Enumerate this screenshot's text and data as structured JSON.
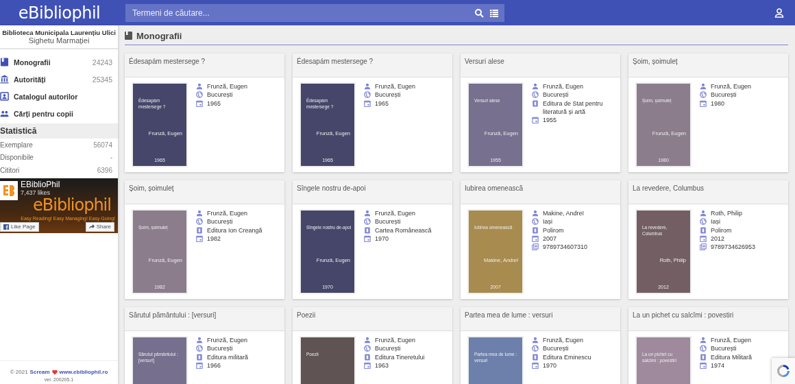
{
  "header": {
    "logo": "eBibliophil",
    "search": {
      "placeholder": "Termeni de căutare..."
    }
  },
  "sidebar": {
    "library_name": "Biblioteca Municipala Laurențiu Ulici",
    "library_city": "Sighetu Marmației",
    "items": [
      {
        "kind": "book",
        "label": "Monografii",
        "count": "24243"
      },
      {
        "kind": "institution",
        "label": "Autorități",
        "count": "25345"
      },
      {
        "kind": "contact",
        "label": "Catalogul autorilor"
      },
      {
        "kind": "people",
        "label": "Cărți pentru copii"
      }
    ],
    "stats_title": "Statistică",
    "stats": [
      {
        "label": "Exemplare",
        "value": "56074"
      },
      {
        "label": "Disponibile",
        "value": "-"
      },
      {
        "label": "Cititori",
        "value": "6396"
      }
    ],
    "facebook": {
      "page_name": "EBiblioPhil",
      "likes": "7,437 likes",
      "banner_title": "eBibliophil",
      "banner_tagline": "Easy Reading! Easy Managing! Easy Going!",
      "like_button": "Like Page",
      "share_button": "Share"
    },
    "footer": {
      "copyright": "© 2021",
      "author": "Scream",
      "site": "www.ebibliophil.ro",
      "version": "ver. 200205.1"
    }
  },
  "section": {
    "title": "Monografii"
  },
  "books": [
    {
      "title": "Édesapám mestersege ?",
      "cover": {
        "color": "#45466a",
        "title": "Édesapám mestersege ?",
        "author": "Frunză, Eugen",
        "year": "1965"
      },
      "details": [
        {
          "kind": "author",
          "text": "Frunză, Eugen"
        },
        {
          "kind": "place",
          "text": "București"
        },
        {
          "kind": "year",
          "text": "1965"
        }
      ]
    },
    {
      "title": "Édesapám mestersege ?",
      "cover": {
        "color": "#45466a",
        "title": "Édesapám mestersege ?",
        "author": "Frunză, Eugen",
        "year": "1965"
      },
      "details": [
        {
          "kind": "author",
          "text": "Frunză, Eugen"
        },
        {
          "kind": "place",
          "text": "București"
        },
        {
          "kind": "year",
          "text": "1965"
        }
      ]
    },
    {
      "title": "Versuri alese",
      "cover": {
        "color": "#77708f",
        "title": "Versuri alese",
        "author": "Frunză, Eugen",
        "year": "1955"
      },
      "details": [
        {
          "kind": "author",
          "text": "Frunză, Eugen"
        },
        {
          "kind": "place",
          "text": "București"
        },
        {
          "kind": "publisher",
          "text": "Editura de Stat pentru literatură și artă"
        },
        {
          "kind": "year",
          "text": "1955"
        }
      ]
    },
    {
      "title": "Șoim, șoimuleț",
      "cover": {
        "color": "#8b7d8c",
        "title": "Șoim, șoimuleț",
        "author": "Frunză, Eugen",
        "year": "1980"
      },
      "details": [
        {
          "kind": "author",
          "text": "Frunză, Eugen"
        },
        {
          "kind": "place",
          "text": "București"
        },
        {
          "kind": "year",
          "text": "1980"
        }
      ]
    },
    {
      "title": "Șoim, șoimuleț",
      "cover": {
        "color": "#8b7d8c",
        "title": "Șoim, șoimuleț",
        "author": "Frunză, Eugen",
        "year": "1982"
      },
      "details": [
        {
          "kind": "author",
          "text": "Frunză, Eugen"
        },
        {
          "kind": "place",
          "text": "București"
        },
        {
          "kind": "publisher",
          "text": "Editura Ion Creangă"
        },
        {
          "kind": "year",
          "text": "1982"
        }
      ]
    },
    {
      "title": "Sîngele nostru de-apoi",
      "cover": {
        "color": "#45466a",
        "title": "Sîngele nostru de-apoi",
        "author": "Frunză, Eugen",
        "year": "1970"
      },
      "details": [
        {
          "kind": "author",
          "text": "Frunză, Eugen"
        },
        {
          "kind": "place",
          "text": "București"
        },
        {
          "kind": "publisher",
          "text": "Cartea Românească"
        },
        {
          "kind": "year",
          "text": "1970"
        }
      ]
    },
    {
      "title": "Iubirea omenească",
      "cover": {
        "color": "#a88b4e",
        "title": "Iubirea omenească",
        "author": "Makine, Andreï",
        "year": "2007"
      },
      "details": [
        {
          "kind": "author",
          "text": "Makine, Andreï"
        },
        {
          "kind": "place",
          "text": "Iași"
        },
        {
          "kind": "publisher",
          "text": "Polirom"
        },
        {
          "kind": "year",
          "text": "2007"
        },
        {
          "kind": "isbn",
          "text": "9789734607310"
        }
      ]
    },
    {
      "title": "La revedere, Columbus",
      "cover": {
        "color": "#735f63",
        "title": "La revedere, Columbus",
        "author": "Roth, Philip",
        "year": "2012"
      },
      "details": [
        {
          "kind": "author",
          "text": "Roth, Philip"
        },
        {
          "kind": "place",
          "text": "Iași"
        },
        {
          "kind": "publisher",
          "text": "Polirom"
        },
        {
          "kind": "year",
          "text": "2012"
        },
        {
          "kind": "isbn",
          "text": "9789734626953"
        }
      ]
    },
    {
      "title": "Sărutul pământului : [versuri]",
      "cover": {
        "color": "#776f8e",
        "title": "Sărutul pământului : [versuri]"
      },
      "details": [
        {
          "kind": "author",
          "text": "Frunză, Eugen"
        },
        {
          "kind": "place",
          "text": "București"
        },
        {
          "kind": "publisher",
          "text": "Editura militară"
        },
        {
          "kind": "year",
          "text": "1966"
        }
      ]
    },
    {
      "title": "Poezii",
      "cover": {
        "color": "#5f5453",
        "title": "Poezii"
      },
      "details": [
        {
          "kind": "author",
          "text": "Frunză, Eugen"
        },
        {
          "kind": "place",
          "text": "București"
        },
        {
          "kind": "publisher",
          "text": "Editura Tineretului"
        },
        {
          "kind": "year",
          "text": "1963"
        }
      ]
    },
    {
      "title": "Partea mea de lume : versuri",
      "cover": {
        "color": "#6d80ab",
        "title": "Partea mea de lume : versuri"
      },
      "details": [
        {
          "kind": "author",
          "text": "Frunză, Eugen"
        },
        {
          "kind": "place",
          "text": "București"
        },
        {
          "kind": "publisher",
          "text": "Editura Eminescu"
        },
        {
          "kind": "year",
          "text": "1970"
        }
      ]
    },
    {
      "title": "La un pichet cu salcîmi : povestiri",
      "cover": {
        "color": "#9e8a9c",
        "title": "La un pichet cu salcîmi : povestiri"
      },
      "details": [
        {
          "kind": "author",
          "text": "Frunză, Eugen"
        },
        {
          "kind": "place",
          "text": "București"
        },
        {
          "kind": "publisher",
          "text": "Editura Militară"
        },
        {
          "kind": "year",
          "text": "1974"
        }
      ]
    }
  ]
}
